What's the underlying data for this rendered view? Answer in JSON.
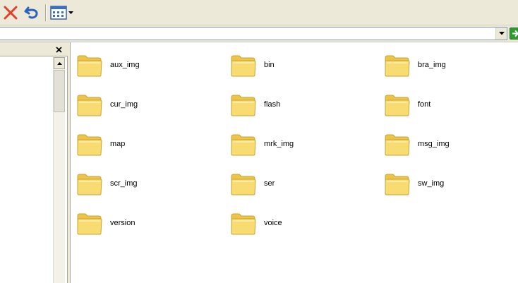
{
  "toolbar": {
    "buttons": [
      {
        "name": "delete",
        "icon": "red-x-icon",
        "color": "#e2402a"
      },
      {
        "name": "undo",
        "icon": "undo-arrow-icon",
        "color": "#2a62c4"
      },
      {
        "name": "views",
        "icon": "views-grid-icon",
        "has_dropdown": true
      }
    ]
  },
  "address_bar": {
    "value": ""
  },
  "left_pane": {
    "close_icon": "close-x-icon"
  },
  "files": {
    "items": [
      {
        "name": "aux_img"
      },
      {
        "name": "bin"
      },
      {
        "name": "bra_img"
      },
      {
        "name": "cur_img"
      },
      {
        "name": "flash"
      },
      {
        "name": "font"
      },
      {
        "name": "map"
      },
      {
        "name": "mrk_img"
      },
      {
        "name": "msg_img"
      },
      {
        "name": "scr_img"
      },
      {
        "name": "ser"
      },
      {
        "name": "sw_img"
      },
      {
        "name": "version"
      },
      {
        "name": "voice"
      }
    ]
  },
  "colors": {
    "chrome": "#ece9d8",
    "folder_fill": "#f8dc72",
    "folder_edge": "#c9a532"
  }
}
